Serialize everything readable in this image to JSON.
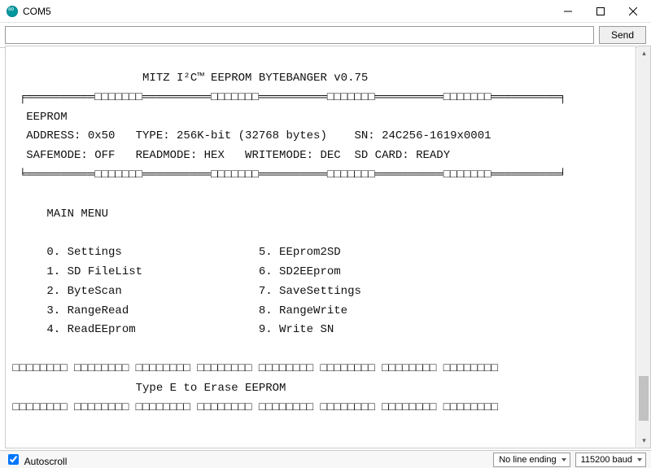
{
  "window": {
    "title": "COM5",
    "send_label": "Send"
  },
  "input": {
    "value": "",
    "placeholder": ""
  },
  "status": {
    "autoscroll_label": "Autoscroll",
    "autoscroll_checked": true,
    "line_ending": "No line ending",
    "baud": "115200 baud"
  },
  "terminal": {
    "lines": [
      "                    MITZ I²C™ EEPROM BYTEBANGER v0.75",
      "  ╒══════════□□□□□□□══════════□□□□□□□══════════□□□□□□□══════════□□□□□□□══════════╕",
      "   EEPROM",
      "   ADDRESS: 0x50   TYPE: 256K-bit (32768 bytes)    SN: 24C256-1619x0001",
      "   SAFEMODE: OFF   READMODE: HEX   WRITEMODE: DEC  SD CARD: READY",
      "  ╘══════════□□□□□□□══════════□□□□□□□══════════□□□□□□□══════════□□□□□□□══════════╛",
      "",
      "      MAIN MENU",
      "",
      "      0. Settings                    5. EEprom2SD",
      "      1. SD FileList                 6. SD2EEprom",
      "      2. ByteScan                    7. SaveSettings",
      "      3. RangeRead                   8. RangeWrite",
      "      4. ReadEEprom                  9. Write SN",
      "",
      " □□□□□□□□ □□□□□□□□ □□□□□□□□ □□□□□□□□ □□□□□□□□ □□□□□□□□ □□□□□□□□ □□□□□□□□",
      "                   Type E to Erase EEPROM",
      " □□□□□□□□ □□□□□□□□ □□□□□□□□ □□□□□□□□ □□□□□□□□ □□□□□□□□ □□□□□□□□ □□□□□□□□"
    ]
  },
  "eeprom_info": {
    "address": "0x50",
    "type": "256K-bit (32768 bytes)",
    "sn": "24C256-1619x0001",
    "safemode": "OFF",
    "readmode": "HEX",
    "writemode": "DEC",
    "sd_card": "READY"
  },
  "menu": {
    "title": "MAIN MENU",
    "items": [
      {
        "key": "0",
        "label": "Settings"
      },
      {
        "key": "1",
        "label": "SD FileList"
      },
      {
        "key": "2",
        "label": "ByteScan"
      },
      {
        "key": "3",
        "label": "RangeRead"
      },
      {
        "key": "4",
        "label": "ReadEEprom"
      },
      {
        "key": "5",
        "label": "EEprom2SD"
      },
      {
        "key": "6",
        "label": "SD2EEprom"
      },
      {
        "key": "7",
        "label": "SaveSettings"
      },
      {
        "key": "8",
        "label": "RangeWrite"
      },
      {
        "key": "9",
        "label": "Write SN"
      }
    ],
    "erase_hint": "Type E to Erase EEPROM"
  },
  "app": {
    "name": "MITZ I²C™ EEPROM BYTEBANGER",
    "version": "v0.75"
  }
}
